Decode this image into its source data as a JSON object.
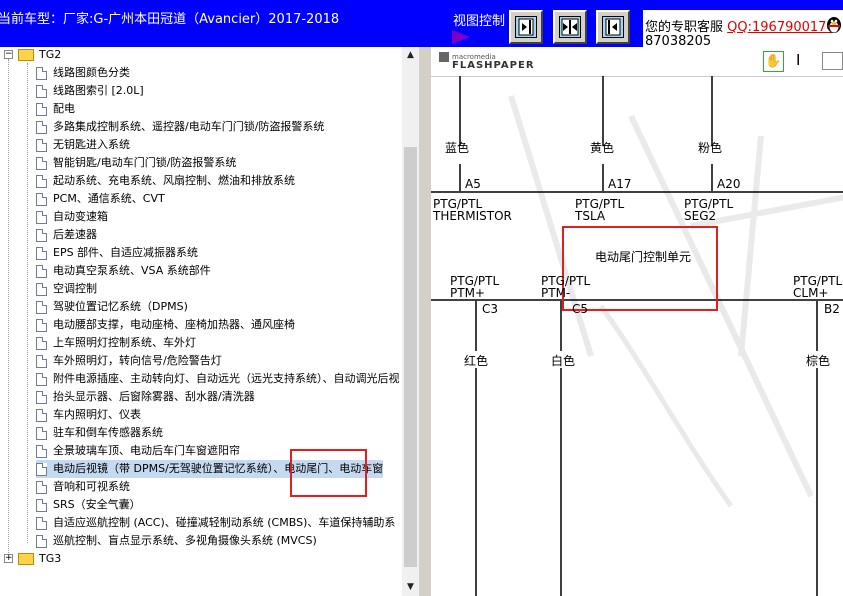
{
  "header": {
    "car_title": "当前车型：厂家:G-广州本田冠道（Avancier）2017-2018",
    "view_control_label": "视图控制",
    "support_text": "您的专职客服",
    "support_qq": "QQ:1967900174",
    "support_line2": "87038205"
  },
  "view_buttons": [
    {
      "name": "expand-right"
    },
    {
      "name": "split-view"
    },
    {
      "name": "collapse-left"
    }
  ],
  "tree": {
    "root": "TG2",
    "items": [
      "线路图颜色分类",
      "线路图索引 [2.0L]",
      "配电",
      "多路集成控制系统、遥控器/电动车门门锁/防盗报警系统",
      "无钥匙进入系统",
      "智能钥匙/电动车门门锁/防盗报警系统",
      "起动系统、充电系统、风扇控制、燃油和排放系统",
      "PCM、通信系统、CVT",
      "自动变速箱",
      "后差速器",
      "EPS 部件、自适应减振器系统",
      "电动真空泵系统、VSA 系统部件",
      "空调控制",
      "驾驶位置记忆系统（DPMS)",
      "电动腰部支撑，电动座椅、座椅加热器、通风座椅",
      "上车照明灯控制系统、车外灯",
      "车外照明灯，转向信号/危险警告灯",
      "附件电源插座、主动转向灯、自动远光（远光支持系统）、自动调光后视",
      "抬头显示器、后窗除雾器、刮水器/清洗器",
      "车内照明灯、仪表",
      "驻车和倒车传感器系统",
      "全景玻璃车顶、电动后车门车窗遮阳帘",
      "电动后视镜（带 DPMS/无驾驶位置记忆系统）、电动尾门、电动车窗",
      "音响和可视系统",
      "SRS（安全气囊）",
      "自适应巡航控制 (ACC)、碰撞减轻制动系统 (CMBS)、车道保持辅助系",
      "巡航控制、盲点显示系统、多视角摄像头系统 (MVCS)"
    ],
    "selected_index": 22,
    "next_root": "TG3"
  },
  "viewer": {
    "brand_top": "macromedia",
    "brand_bottom": "FLASHPAPER"
  },
  "diagram": {
    "wire_colors_top": [
      "蓝色",
      "黄色",
      "粉色"
    ],
    "pins_top": [
      "A5",
      "A17",
      "A20"
    ],
    "signals_top": [
      {
        "line1": "PTG/PTL",
        "line2": "THERMISTOR"
      },
      {
        "line1": "PTG/PTL",
        "line2": "TSLA"
      },
      {
        "line1": "PTG/PTL",
        "line2": "SEG2"
      }
    ],
    "unit_name": "电动尾门控制单元",
    "signals_bottom": [
      {
        "line1": "PTG/PTL",
        "line2": "PTM+"
      },
      {
        "line1": "PTG/PTL",
        "line2": "PTM-"
      },
      {
        "line1": "PTG/PTL",
        "line2": "CLM+"
      }
    ],
    "pins_bottom": [
      "C3",
      "C5",
      "B2"
    ],
    "wire_colors_bottom": [
      "红色",
      "白色",
      "棕色"
    ]
  }
}
